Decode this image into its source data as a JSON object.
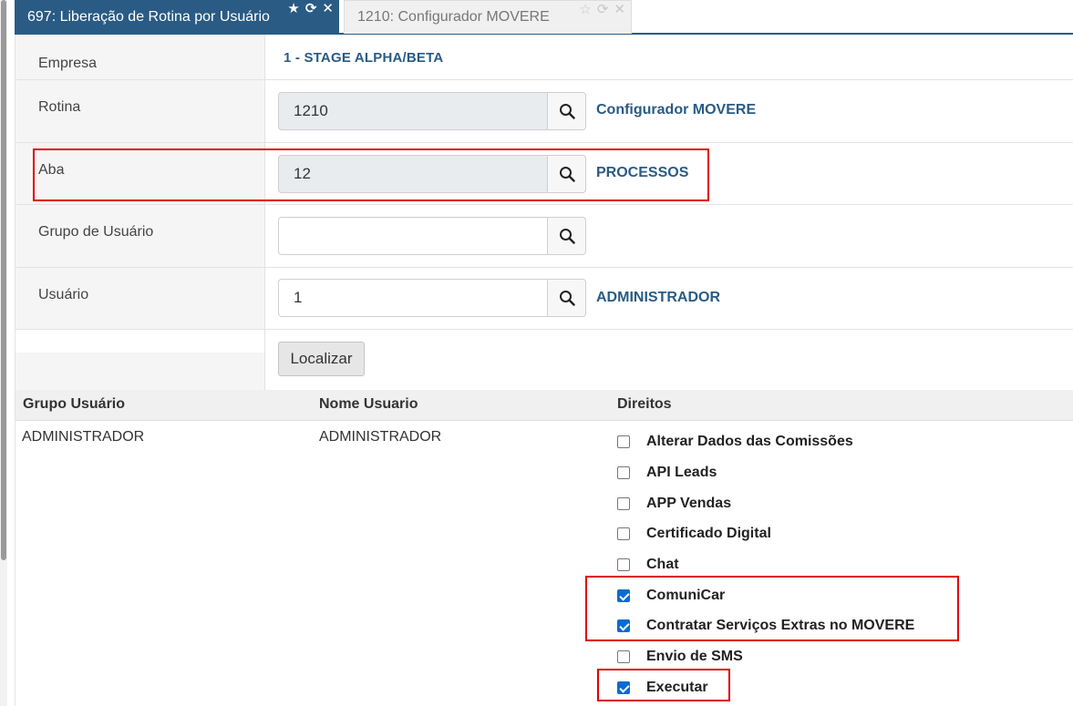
{
  "tabs": [
    {
      "label": "697: Liberação de Rotina por Usuário",
      "active": true
    },
    {
      "label": "1210: Configurador MOVERE",
      "active": false
    }
  ],
  "form": {
    "empresa": {
      "label": "Empresa",
      "value": "1 - STAGE ALPHA/BETA"
    },
    "rotina": {
      "label": "Rotina",
      "value": "1210",
      "description": "Configurador MOVERE"
    },
    "aba": {
      "label": "Aba",
      "value": "12",
      "description": "PROCESSOS"
    },
    "grupo": {
      "label": "Grupo de Usuário",
      "value": "",
      "description": ""
    },
    "usuario": {
      "label": "Usuário",
      "value": "1",
      "description": "ADMINISTRADOR"
    },
    "localizar_label": "Localizar"
  },
  "table": {
    "headers": [
      "Grupo Usuário",
      "Nome Usuario",
      "Direitos"
    ],
    "row": {
      "grupo": "ADMINISTRADOR",
      "nome": "ADMINISTRADOR",
      "direitos": [
        {
          "label": "Alterar Dados das Comissões",
          "checked": false
        },
        {
          "label": "API Leads",
          "checked": false
        },
        {
          "label": "APP Vendas",
          "checked": false
        },
        {
          "label": "Certificado Digital",
          "checked": false
        },
        {
          "label": "Chat",
          "checked": false
        },
        {
          "label": "ComuniCar",
          "checked": true
        },
        {
          "label": "Contratar Serviços Extras no MOVERE",
          "checked": true
        },
        {
          "label": "Envio de SMS",
          "checked": false
        },
        {
          "label": "Executar",
          "checked": true
        }
      ]
    }
  },
  "colors": {
    "accent": "#2a5b84",
    "highlight": "#e00000",
    "checkbox": "#0a6bd1"
  }
}
